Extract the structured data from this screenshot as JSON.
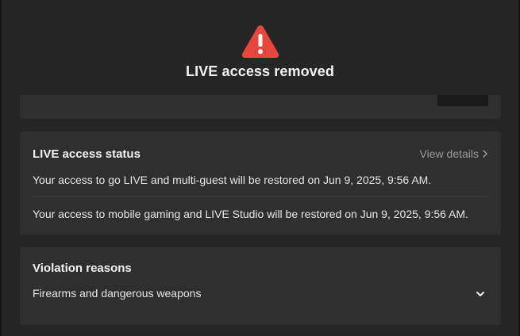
{
  "header": {
    "title": "LIVE access removed",
    "icon": "warning-triangle-icon",
    "icon_color": "#e8463c"
  },
  "status_card": {
    "heading": "LIVE access status",
    "view_details_label": "View details",
    "line1": "Your access to go LIVE and multi-guest will be restored on Jun 9, 2025, 9:56 AM.",
    "line2": "Your access to mobile gaming and LIVE Studio will be restored on Jun 9, 2025, 9:56 AM."
  },
  "violation_card": {
    "heading": "Violation reasons",
    "reason": "Firearms and dangerous weapons"
  },
  "colors": {
    "background": "#262626",
    "card": "#2f2f2f",
    "muted_text": "#9a9a9a"
  }
}
